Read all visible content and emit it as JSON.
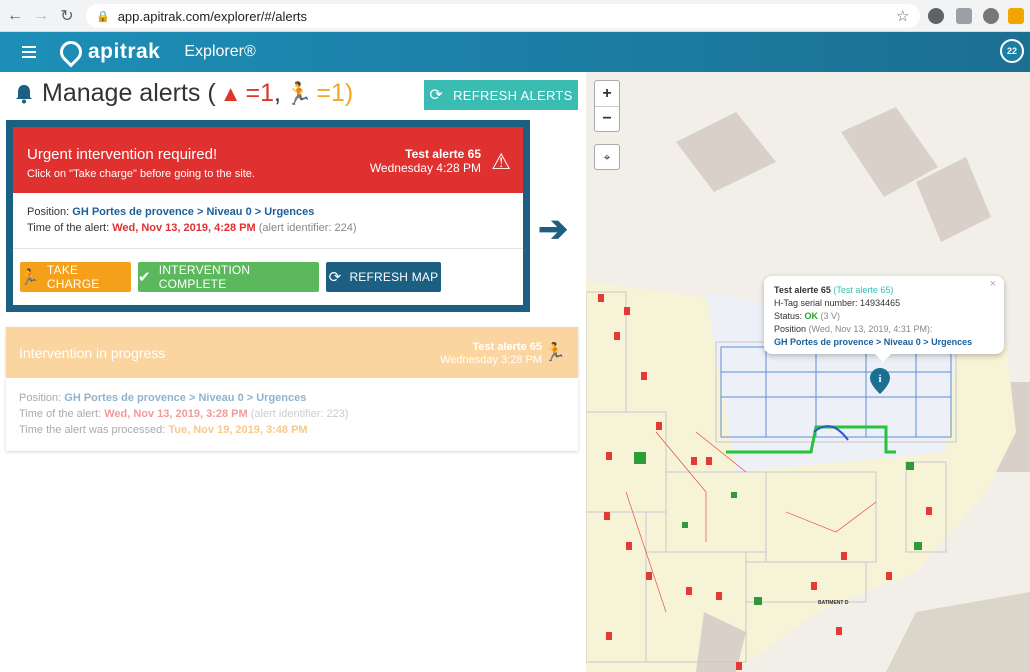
{
  "browser": {
    "url": "app.apitrak.com/explorer/#/alerts"
  },
  "app": {
    "brand": "apitrak",
    "brand_sub": "Explorer®",
    "avatar_count": "22"
  },
  "page": {
    "title": "Manage alerts (",
    "urgent_count": "=1",
    "separator": ",",
    "progress_count": "=1)",
    "refresh_alerts_label": "REFRESH ALERTS"
  },
  "urgent_alert": {
    "heading": "Urgent intervention required!",
    "subheading": "Click on \"Take charge\" before going to the site.",
    "tag_name": "Test alerte 65",
    "tag_time": "Wednesday 4:28 PM",
    "position_label": "Position:",
    "position_value": "GH Portes de provence > Niveau 0 > Urgences",
    "time_label": "Time of the alert:",
    "time_value": "Wed, Nov 13, 2019, 4:28 PM",
    "identifier": "(alert identifier: 224)",
    "take_charge_label": "TAKE CHARGE",
    "complete_label": "INTERVENTION COMPLETE",
    "refresh_map_label": "REFRESH MAP"
  },
  "progress_alert": {
    "heading": "Intervention in progress",
    "tag_name": "Test alerte 65",
    "tag_time": "Wednesday 3:28 PM",
    "position_label": "Position:",
    "position_value": "GH Portes de provence > Niveau 0 > Urgences",
    "time_label": "Time of the alert:",
    "time_value": "Wed, Nov 13, 2019, 3:28 PM",
    "identifier": "(alert identifier: 223)",
    "processed_label": "Time the alert was processed:",
    "processed_value": "Tue, Nov 19, 2019, 3:48 PM"
  },
  "map": {
    "zoom_in": "+",
    "zoom_out": "−",
    "popup": {
      "close": "×",
      "tag_name": "Test alerte 65",
      "tag_alias": "(Test alerte 65)",
      "serial_label": "H-Tag serial number:",
      "serial_value": "14934465",
      "status_label": "Status:",
      "status_value": "OK",
      "status_voltage": "(3 V)",
      "position_label": "Position",
      "position_time": "(Wed, Nov 13, 2019, 4:31 PM):",
      "position_value": "GH Portes de provence > Niveau 0 > Urgences"
    },
    "building_label": "BATIMENT D"
  },
  "colors": {
    "urgent": "#e03131",
    "progress": "#fbd5a0",
    "accent": "#3bbcb3",
    "frame": "#1b5f82"
  }
}
